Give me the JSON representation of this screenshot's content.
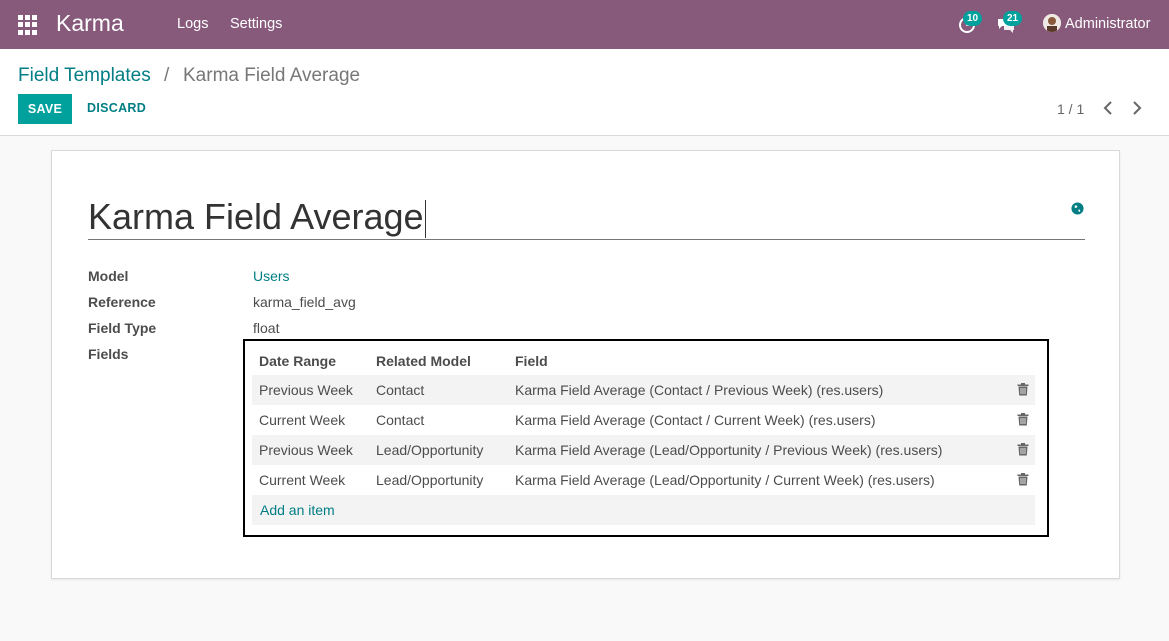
{
  "navbar": {
    "brand": "Karma",
    "menu": [
      "Logs",
      "Settings"
    ],
    "activity_count": "10",
    "messages_count": "21",
    "user_name": "Administrator"
  },
  "breadcrumb": {
    "parent": "Field Templates",
    "separator": "/",
    "current": "Karma Field Average"
  },
  "actions": {
    "save_label": "SAVE",
    "discard_label": "DISCARD"
  },
  "pager": {
    "value": "1 / 1"
  },
  "form": {
    "title": "Karma Field Average",
    "labels": {
      "model": "Model",
      "reference": "Reference",
      "field_type": "Field Type",
      "fields": "Fields"
    },
    "model": "Users",
    "reference": "karma_field_avg",
    "field_type": "float",
    "fields_table": {
      "headers": [
        "Date Range",
        "Related Model",
        "Field"
      ],
      "rows": [
        [
          "Previous Week",
          "Contact",
          "Karma Field Average (Contact / Previous Week) (res.users)"
        ],
        [
          "Current Week",
          "Contact",
          "Karma Field Average (Contact / Current Week) (res.users)"
        ],
        [
          "Previous Week",
          "Lead/Opportunity",
          "Karma Field Average (Lead/Opportunity / Previous Week) (res.users)"
        ],
        [
          "Current Week",
          "Lead/Opportunity",
          "Karma Field Average (Lead/Opportunity / Current Week) (res.users)"
        ]
      ],
      "add_label": "Add an item"
    }
  },
  "colors": {
    "navbar": "#875a7b",
    "accent": "#00a09d",
    "link": "#017e84"
  }
}
